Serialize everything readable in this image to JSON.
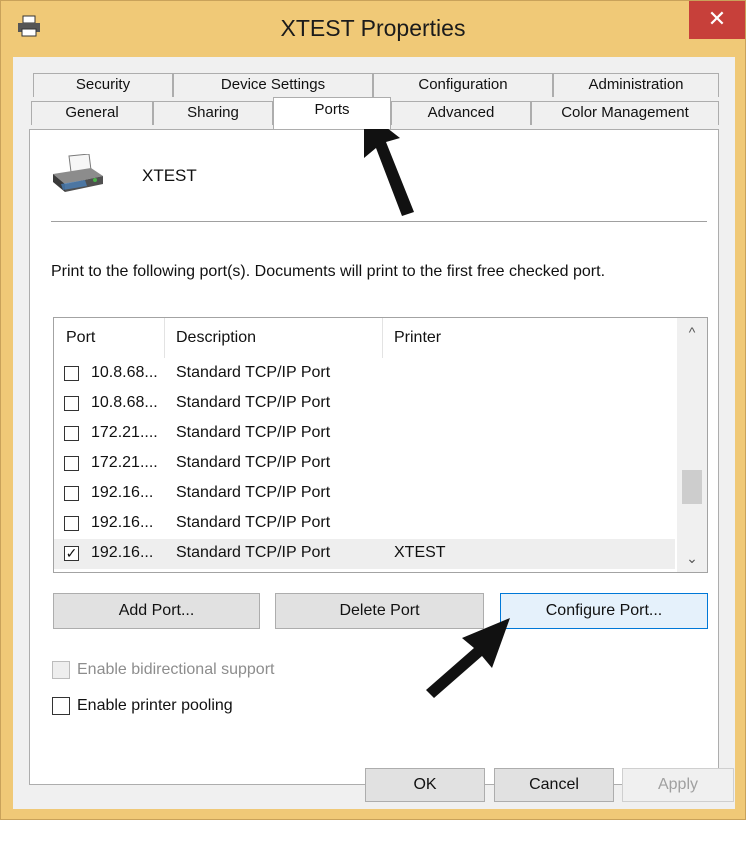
{
  "window": {
    "title": "XTEST Properties",
    "close_glyph": "✕"
  },
  "tabs": {
    "row1": [
      "Security",
      "Device Settings",
      "Configuration",
      "Administration"
    ],
    "row2": [
      "General",
      "Sharing",
      "Ports",
      "Advanced",
      "Color Management"
    ],
    "active": "Ports"
  },
  "printer": {
    "name": "XTEST",
    "icon": "printer-icon"
  },
  "description": "Print to the following port(s). Documents will print to the first free checked port.",
  "ports_table": {
    "columns": [
      "Port",
      "Description",
      "Printer"
    ],
    "rows": [
      {
        "port": "10.8.68...",
        "description": "Standard TCP/IP Port",
        "printer": "",
        "checked": false
      },
      {
        "port": "10.8.68...",
        "description": "Standard TCP/IP Port",
        "printer": "",
        "checked": false
      },
      {
        "port": "172.21....",
        "description": "Standard TCP/IP Port",
        "printer": "",
        "checked": false
      },
      {
        "port": "172.21....",
        "description": "Standard TCP/IP Port",
        "printer": "",
        "checked": false
      },
      {
        "port": "192.16...",
        "description": "Standard TCP/IP Port",
        "printer": "",
        "checked": false
      },
      {
        "port": "192.16...",
        "description": "Standard TCP/IP Port",
        "printer": "",
        "checked": false
      },
      {
        "port": "192.16...",
        "description": "Standard TCP/IP Port",
        "printer": "XTEST",
        "checked": true
      }
    ],
    "scroll_up_glyph": "^",
    "scroll_down_glyph": "⌄"
  },
  "buttons": {
    "add_port": "Add Port...",
    "delete_port": "Delete Port",
    "configure_port": "Configure Port..."
  },
  "options": {
    "bidirectional": "Enable bidirectional support",
    "pooling": "Enable printer pooling"
  },
  "footer": {
    "ok": "OK",
    "cancel": "Cancel",
    "apply": "Apply"
  },
  "colors": {
    "title_bar": "#f0c977",
    "close_button": "#c7403a",
    "focus_border": "#0078d7"
  }
}
